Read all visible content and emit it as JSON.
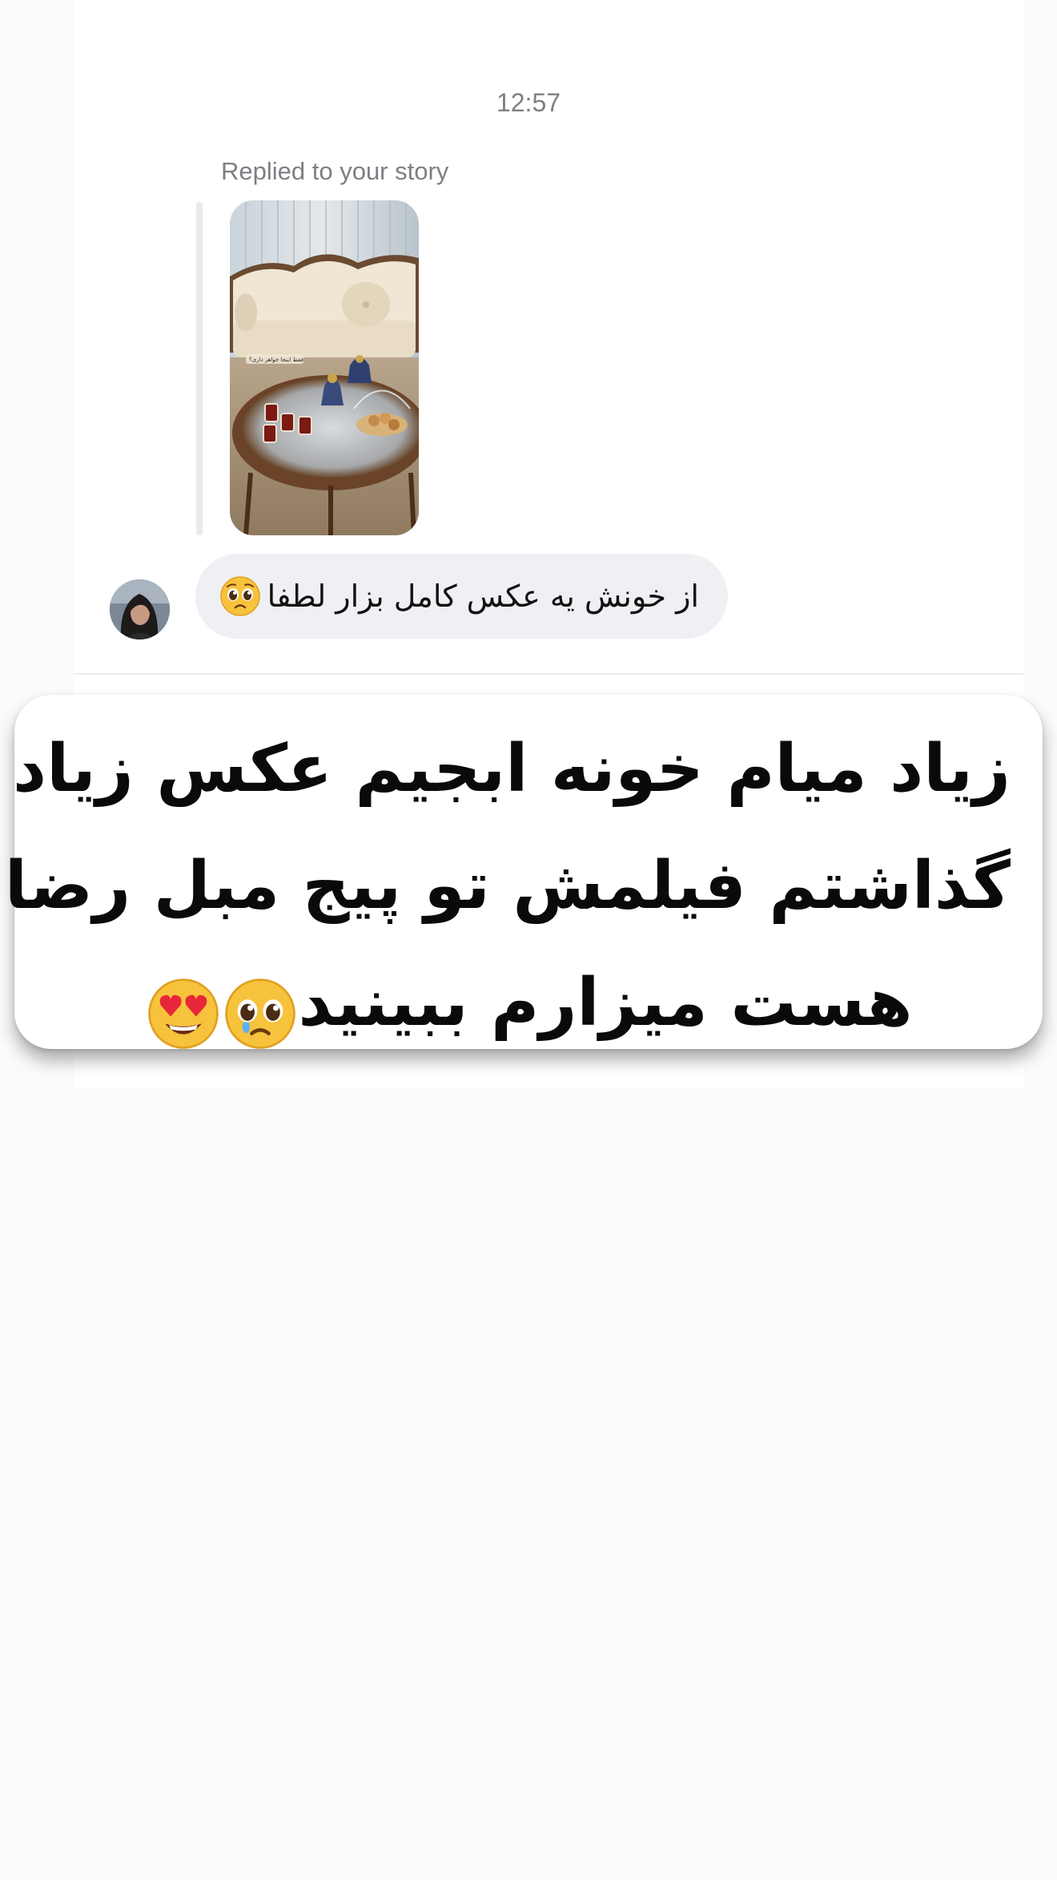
{
  "chat": {
    "timestamp": "12:57",
    "reply_label": "Replied to your story",
    "story_overlay_text": "فقط اینجا خواهر داری؟",
    "message": {
      "text": "از خونش یه عکس کامل بزار لطفا",
      "emoji": "pleading-face-emoji"
    }
  },
  "caption": {
    "line1": "زیاد میام خونه ابجیم عکس زیاد",
    "line2": "گذاشتم فیلمش تو پیج مبل رضا",
    "line3": "هست میزارم ببینید",
    "line3_emojis": [
      "pleading-face-emoji",
      "heart-eyes-emoji"
    ]
  },
  "colors": {
    "bubble_bg": "#eff0f3",
    "meta_text": "#7d7f84",
    "page_bg": "#fbfbfb"
  }
}
